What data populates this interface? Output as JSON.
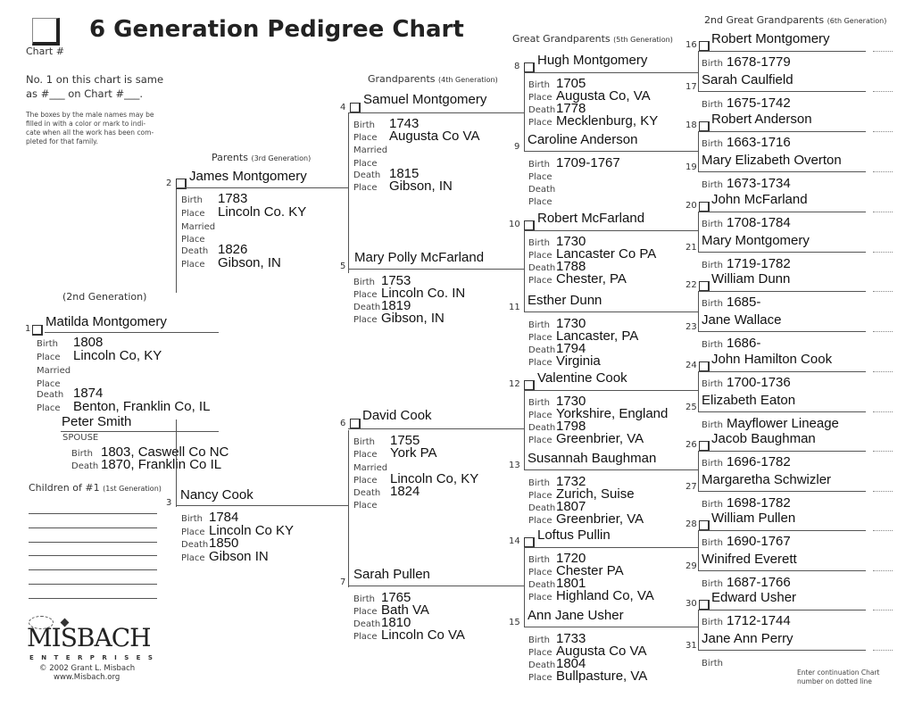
{
  "header": {
    "title": "6 Generation Pedigree Chart",
    "chart_num_label": "Chart #",
    "same_as_line1": "No. 1 on this chart is same",
    "same_as_line2": "as #___ on Chart #___.",
    "instructions": [
      "The boxes by the male names may be",
      "filled in with a color or mark to indi-",
      "cate when all the work has been com-",
      "pleted for that family."
    ]
  },
  "generations": {
    "g2": {
      "main": "(2nd Generation)",
      "sub": ""
    },
    "g3": {
      "main": "Parents",
      "sub": "(3rd Generation)"
    },
    "g4": {
      "main": "Grandparents",
      "sub": "(4th Generation)"
    },
    "g5": {
      "main": "Great Grandparents",
      "sub": "(5th Generation)"
    },
    "g6": {
      "main": "2nd Great Grandparents",
      "sub": "(6th Generation)"
    },
    "g1": {
      "main": "Children of #1",
      "sub": "(1st Generation)"
    }
  },
  "labels": {
    "birth": "Birth",
    "place": "Place",
    "married": "Married",
    "death": "Death",
    "spouse": "SPOUSE"
  },
  "persons": {
    "p1": {
      "num": "1",
      "name": "Matilda Montgomery",
      "birth": "1808",
      "birth_place": "Lincoln Co, KY",
      "married": "",
      "married_place": "",
      "death": "1874",
      "death_place": "Benton, Franklin Co, IL"
    },
    "spouse": {
      "name": "Peter Smith",
      "birth": "1803, Caswell Co NC",
      "death": "1870, Franklin Co IL"
    },
    "p2": {
      "num": "2",
      "name": "James Montgomery",
      "birth": "1783",
      "birth_place": "Lincoln Co. KY",
      "death": "1826",
      "death_place": "Gibson, IN"
    },
    "p3": {
      "num": "3",
      "name": "Nancy Cook",
      "birth": "1784",
      "birth_place": "Lincoln Co KY",
      "death": "1850",
      "death_place": "Gibson IN"
    },
    "p4": {
      "num": "4",
      "name": "Samuel Montgomery",
      "birth": "1743",
      "birth_place": "Augusta Co VA",
      "death": "1815",
      "death_place": "Gibson, IN"
    },
    "p5": {
      "num": "5",
      "name": "Mary Polly McFarland",
      "birth": "1753",
      "birth_place": "Lincoln Co. IN",
      "death": "1819",
      "death_place": "Gibson, IN"
    },
    "p6": {
      "num": "6",
      "name": "David Cook",
      "birth": "1755",
      "birth_place": "York PA",
      "married_place": "Lincoln Co, KY",
      "death": "1824",
      "death_place": ""
    },
    "p7": {
      "num": "7",
      "name": "Sarah Pullen",
      "birth": "1765",
      "birth_place": "Bath VA",
      "death": "1810",
      "death_place": "Lincoln Co VA"
    },
    "p8": {
      "num": "8",
      "name": "Hugh Montgomery",
      "birth": "1705",
      "birth_place": "Augusta Co, VA",
      "death": "1778",
      "death_place": "Mecklenburg, KY"
    },
    "p9": {
      "num": "9",
      "name": "Caroline Anderson",
      "birth": "1709-1767",
      "birth_place": "",
      "death": "",
      "death_place": ""
    },
    "p10": {
      "num": "10",
      "name": "Robert McFarland",
      "birth": "1730",
      "birth_place": "Lancaster Co PA",
      "death": "1788",
      "death_place": "Chester, PA"
    },
    "p11": {
      "num": "11",
      "name": "Esther Dunn",
      "birth": "1730",
      "birth_place": "Lancaster, PA",
      "death": "1794",
      "death_place": "Virginia"
    },
    "p12": {
      "num": "12",
      "name": "Valentine Cook",
      "birth": "1730",
      "birth_place": "Yorkshire, England",
      "death": "1798",
      "death_place": "Greenbrier, VA"
    },
    "p13": {
      "num": "13",
      "name": "Susannah Baughman",
      "birth": "1732",
      "birth_place": "Zurich, Suise",
      "death": "1807",
      "death_place": "Greenbrier, VA"
    },
    "p14": {
      "num": "14",
      "name": "Loftus Pullin",
      "birth": "1720",
      "birth_place": "Chester PA",
      "death": "1801",
      "death_place": "Highland Co, VA"
    },
    "p15": {
      "num": "15",
      "name": "Ann Jane Usher",
      "birth": "1733",
      "birth_place": "Augusta Co VA",
      "death": "1804",
      "death_place": "Bullpasture, VA"
    },
    "p16": {
      "num": "16",
      "name": "Robert Montgomery",
      "birth": "1678-1779"
    },
    "p17": {
      "num": "17",
      "name": "Sarah Caulfield",
      "birth": "1675-1742"
    },
    "p18": {
      "num": "18",
      "name": "Robert Anderson",
      "birth": "1663-1716"
    },
    "p19": {
      "num": "19",
      "name": "Mary Elizabeth Overton",
      "birth": "1673-1734"
    },
    "p20": {
      "num": "20",
      "name": "John McFarland",
      "birth": "1708-1784"
    },
    "p21": {
      "num": "21",
      "name": "Mary Montgomery",
      "birth": "1719-1782"
    },
    "p22": {
      "num": "22",
      "name": "William Dunn",
      "birth": "1685-"
    },
    "p23": {
      "num": "23",
      "name": "Jane Wallace",
      "birth": "1686-"
    },
    "p24": {
      "num": "24",
      "name": "John Hamilton Cook",
      "birth": "1700-1736"
    },
    "p25": {
      "num": "25",
      "name": "Elizabeth Eaton",
      "birth": "Mayflower Lineage"
    },
    "p26": {
      "num": "26",
      "name": "Jacob Baughman",
      "birth": "1696-1782"
    },
    "p27": {
      "num": "27",
      "name": "Margaretha Schwizler",
      "birth": "1698-1782"
    },
    "p28": {
      "num": "28",
      "name": "William Pullen",
      "birth": "1690-1767"
    },
    "p29": {
      "num": "29",
      "name": "Winifred Everett",
      "birth": "1687-1766"
    },
    "p30": {
      "num": "30",
      "name": "Edward Usher",
      "birth": "1712-1744"
    },
    "p31": {
      "num": "31",
      "name": "Jane Ann Perry",
      "birth": ""
    }
  },
  "children": [
    "",
    "",
    "",
    "",
    "",
    "",
    ""
  ],
  "footer": {
    "logo": "MISBACH",
    "logo_sub": "E N T E R P R I S E S",
    "copyright": "© 2002 Grant L. Misbach",
    "url": "www.Misbach.org",
    "continuation_note_1": "Enter continuation Chart",
    "continuation_note_2": "number on dotted line"
  }
}
